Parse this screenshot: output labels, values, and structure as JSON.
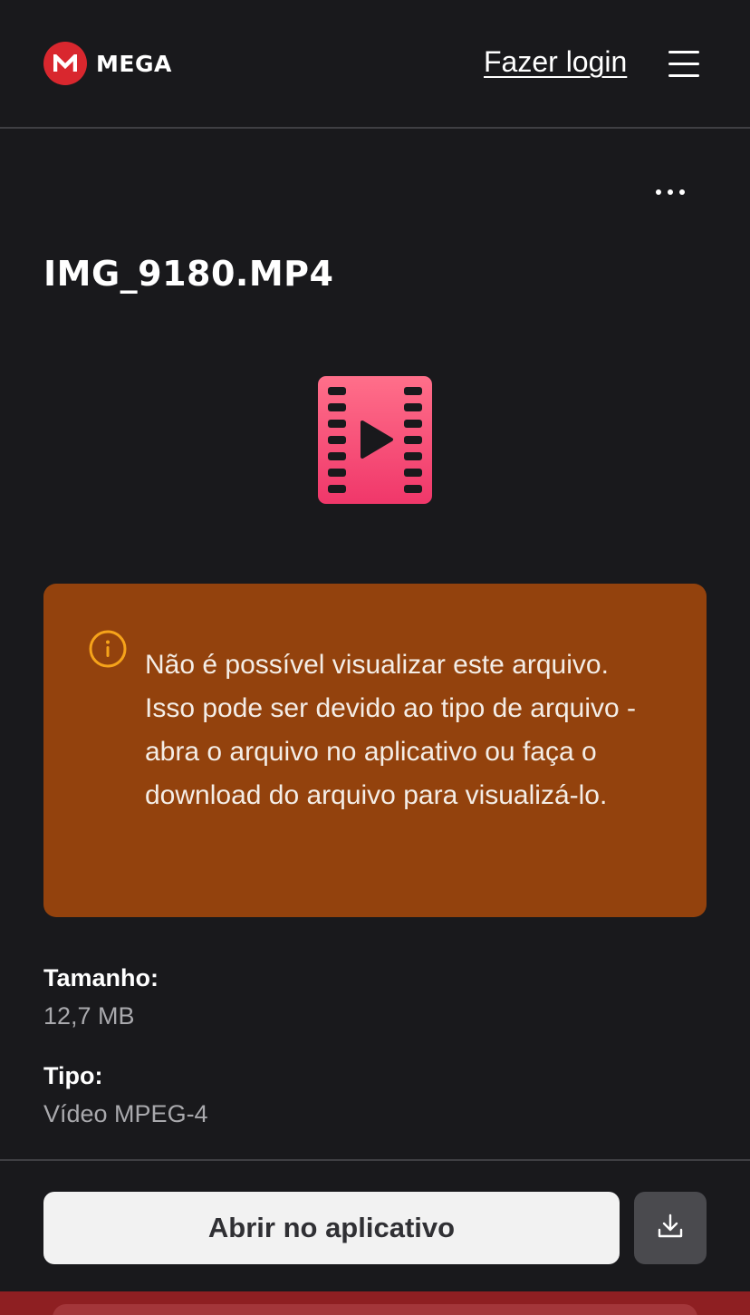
{
  "header": {
    "brand": "MEGA",
    "login_label": "Fazer login"
  },
  "file": {
    "name": "IMG_9180.MP4"
  },
  "warning": {
    "message": "Não é possível visualizar este arquivo. Isso pode ser devido ao tipo de arquivo - abra o arquivo no aplicativo ou faça o download do arquivo para visualizá-lo."
  },
  "details": [
    {
      "label": "Tamanho:",
      "value": "12,7 MB"
    },
    {
      "label": "Tipo:",
      "value": "Vídeo MPEG-4"
    }
  ],
  "actions": {
    "open_app_label": "Abrir no aplicativo"
  },
  "icons": {
    "logo": "mega-logo-icon",
    "menu": "hamburger-menu-icon",
    "more": "more-options-icon",
    "file_type": "video-file-icon",
    "info": "info-icon",
    "download": "download-icon"
  },
  "colors": {
    "background": "#19191c",
    "brand_red": "#d9272e",
    "warning_bg": "#93420d",
    "warning_icon": "#f6a31a",
    "video_icon": "#f0476f"
  }
}
